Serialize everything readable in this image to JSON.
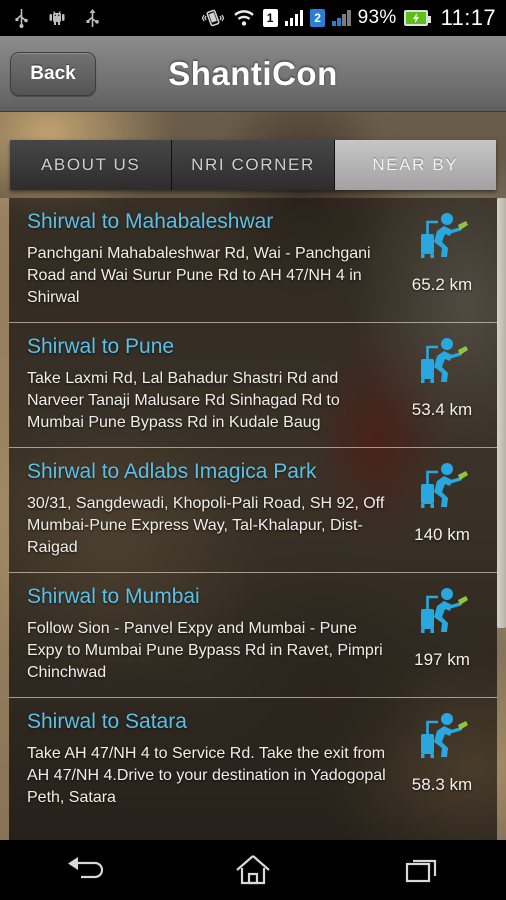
{
  "status_bar": {
    "left_icons": [
      "usb-icon",
      "android-robot-icon",
      "usb-icon"
    ],
    "vibrate_icon": "vibrate-icon",
    "wifi_icon": "wifi-icon",
    "sim1_label": "1",
    "sim2_label": "2",
    "battery_percent": "93%",
    "battery_icon": "battery-charging-icon",
    "clock": "11:17"
  },
  "title_bar": {
    "back_label": "Back",
    "app_title": "ShantiCon"
  },
  "tabs": [
    {
      "label": "ABOUT US",
      "active": false
    },
    {
      "label": "NRI CORNER",
      "active": false
    },
    {
      "label": "NEAR BY",
      "active": true
    }
  ],
  "nearby_list": [
    {
      "title": "Shirwal to Mahabaleshwar",
      "description": "Panchgani Mahabaleshwar Rd, Wai - Panchgani Road and Wai Surur Pune Rd to AH 47/NH 4 in Shirwal",
      "distance": "65.2 km",
      "icon": "traveler-icon"
    },
    {
      "title": "Shirwal to Pune",
      "description": "Take Laxmi Rd, Lal Bahadur Shastri Rd and Narveer Tanaji Malusare Rd Sinhagad Rd to Mumbai Pune Bypass Rd in Kudale Baug",
      "distance": "53.4 km",
      "icon": "traveler-icon"
    },
    {
      "title": "Shirwal to Adlabs Imagica Park",
      "description": "30/31, Sangdewadi, Khopoli-Pali Road, SH 92, Off Mumbai-Pune Express Way, Tal-Khalapur, Dist-Raigad",
      "distance": "140 km",
      "icon": "traveler-icon"
    },
    {
      "title": "Shirwal to Mumbai",
      "description": "Follow Sion - Panvel Expy and Mumbai - Pune Expy to Mumbai Pune Bypass Rd in Ravet, Pimpri Chinchwad",
      "distance": "197 km",
      "icon": "traveler-icon"
    },
    {
      "title": "Shirwal to Satara",
      "description": "Take AH 47/NH 4 to Service Rd. Take the exit from AH 47/NH 4.Drive to your destination in Yadogopal Peth, Satara",
      "distance": "58.3 km",
      "icon": "traveler-icon"
    }
  ],
  "nav_bar": {
    "back_icon": "nav-back-icon",
    "home_icon": "nav-home-icon",
    "recents_icon": "nav-recents-icon"
  },
  "colors": {
    "title_accent": "#5bc0e8",
    "traveler_blue": "#29a8e0",
    "ticket_green": "#8dc63f",
    "battery_green": "#5cbf1a",
    "sim2_blue": "#2a7fd4"
  }
}
